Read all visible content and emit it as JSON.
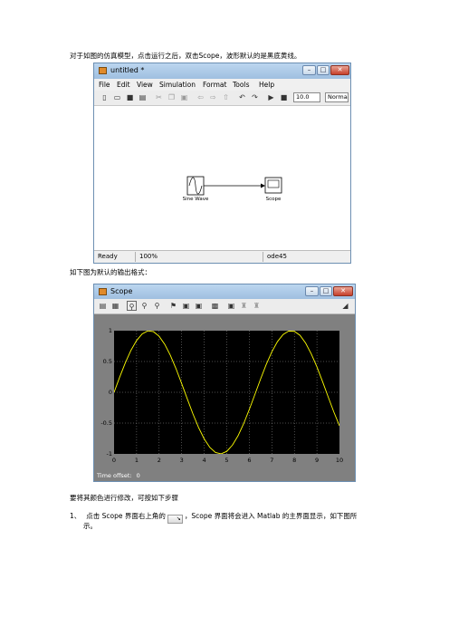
{
  "doc": {
    "para1": "对于如图的仿真模型，点击运行之后，双击Scope，波形默认的是黑底黄线。",
    "para2": "如下图为默认的输出格式：",
    "para3": "要将其颜色进行修改，可按如下步骤",
    "step1_num": "1、",
    "step1_before": "点击 Scope 界面右上角的",
    "step1_after": "，Scope 界面将会进入 Matlab 的主界面显示，如下图所",
    "step1_cont": "示。"
  },
  "model_window": {
    "title": "untitled *",
    "menu": [
      "File",
      "Edit",
      "View",
      "Simulation",
      "Format",
      "Tools",
      "Help"
    ],
    "stop_time": "10.0",
    "sim_mode": "Norma",
    "blocks": {
      "source": "Sine Wave",
      "sink": "Scope"
    },
    "status": {
      "state": "Ready",
      "zoom": "100%",
      "solver": "ode45"
    }
  },
  "scope_window": {
    "title": "Scope",
    "time_offset_label": "Time offset:",
    "time_offset_value": "0"
  },
  "chart_data": {
    "type": "line",
    "title": "",
    "xlabel": "",
    "ylabel": "",
    "xlim": [
      0,
      10
    ],
    "ylim": [
      -1,
      1
    ],
    "x_ticks": [
      "0",
      "1",
      "2",
      "3",
      "4",
      "5",
      "6",
      "7",
      "8",
      "9",
      "10"
    ],
    "y_ticks": [
      "1",
      "0.5",
      "0",
      "-0.5",
      "-1"
    ],
    "grid": true,
    "background": "#000000",
    "line_color": "#ffff00",
    "series": [
      {
        "x": [
          0,
          0.25,
          0.5,
          0.75,
          1,
          1.25,
          1.5,
          1.75,
          2,
          2.25,
          2.5,
          2.75,
          3,
          3.25,
          3.5,
          3.75,
          4,
          4.25,
          4.5,
          4.75,
          5,
          5.25,
          5.5,
          5.75,
          6,
          6.25,
          6.5,
          6.75,
          7,
          7.25,
          7.5,
          7.75,
          8,
          8.25,
          8.5,
          8.75,
          9,
          9.25,
          9.5,
          9.75,
          10
        ],
        "values": [
          0,
          0.247,
          0.479,
          0.682,
          0.841,
          0.949,
          0.997,
          0.984,
          0.909,
          0.778,
          0.598,
          0.382,
          0.141,
          -0.108,
          -0.351,
          -0.572,
          -0.757,
          -0.895,
          -0.977,
          -0.999,
          -0.959,
          -0.859,
          -0.706,
          -0.509,
          -0.279,
          -0.033,
          0.215,
          0.451,
          0.657,
          0.823,
          0.938,
          0.994,
          0.989,
          0.925,
          0.798,
          0.622,
          0.412,
          0.174,
          -0.075,
          -0.32,
          -0.544
        ]
      }
    ]
  }
}
